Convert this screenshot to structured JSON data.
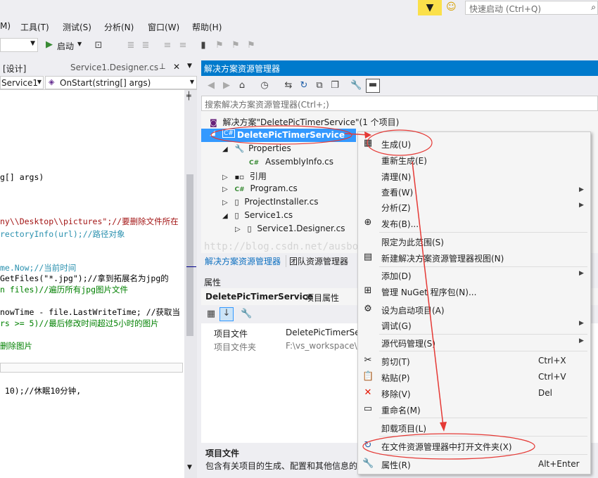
{
  "top": {
    "quick_launch_placeholder": "快速启动 (Ctrl+Q)",
    "notification_icon": "filter-icon",
    "smiley_icon": "smiley-icon"
  },
  "menubar": {
    "items": [
      "M)",
      "工具(T)",
      "测试(S)",
      "分析(N)",
      "窗口(W)",
      "帮助(H)"
    ]
  },
  "toolbar": {
    "start_label": "启动"
  },
  "editor": {
    "tab_design": "[设计]",
    "tab_file": "Service1.Designer.cs",
    "combo_class": "Service1",
    "combo_method": "OnStart(string[] args)",
    "lines": [
      "g[] args)",
      "ny\\\\Desktop\\\\pictures\";//要删除文件所在",
      "rectoryInfo(url);//路径对象",
      "me.Now;//当前时间",
      "GetFiles(\"*.jpg\");//拿到拓展名为jpg的",
      "n files)//遍历所有jpg图片文件",
      "nowTime - file.LastWriteTime; //获取当",
      "rs >= 5)//最后修改时间超过5小时的图片",
      "删除图片",
      " 10);//休眠10分钟,"
    ]
  },
  "solution_explorer": {
    "title": "解决方案资源管理器",
    "search_placeholder": "搜索解决方案资源管理器(Ctrl+;)",
    "tree": {
      "solution": "解决方案\"DeletePicTimerService\"(1 个项目)",
      "project": "DeletePicTimerService",
      "properties": "Properties",
      "assemblyinfo": "AssemblyInfo.cs",
      "references": "引用",
      "program": "Program.cs",
      "projectinstaller": "ProjectInstaller.cs",
      "service1": "Service1.cs",
      "service1_designer": "Service1.Designer.cs"
    },
    "tab_se": "解决方案资源管理器",
    "tab_team": "团队资源管理器",
    "watermark": "http://blog.csdn.net/ausboyue"
  },
  "properties": {
    "title": "属性",
    "object_name": "DeletePicTimerService",
    "object_type": "项目属性",
    "rows": [
      {
        "name": "项目文件",
        "value": "DeletePicTimerSe"
      },
      {
        "name": "项目文件夹",
        "value": "F:\\vs_workspace\\"
      }
    ],
    "desc_title": "项目文件",
    "desc_text": "包含有关项目的生成、配置和其他信息的"
  },
  "context_menu": {
    "items": [
      {
        "label": "生成(U)",
        "shortcut": "",
        "icon": "build-icon",
        "submenu": false
      },
      {
        "label": "重新生成(E)",
        "shortcut": "",
        "icon": "",
        "submenu": false
      },
      {
        "label": "清理(N)",
        "shortcut": "",
        "icon": "",
        "submenu": false
      },
      {
        "label": "查看(W)",
        "shortcut": "",
        "icon": "",
        "submenu": true
      },
      {
        "label": "分析(Z)",
        "shortcut": "",
        "icon": "",
        "submenu": true
      },
      {
        "label": "发布(B)...",
        "shortcut": "",
        "icon": "globe-icon",
        "submenu": false
      },
      {
        "label": "限定为此范围(S)",
        "shortcut": "",
        "icon": "",
        "submenu": false
      },
      {
        "label": "新建解决方案资源管理器视图(N)",
        "shortcut": "",
        "icon": "new-view-icon",
        "submenu": false
      },
      {
        "label": "添加(D)",
        "shortcut": "",
        "icon": "",
        "submenu": true
      },
      {
        "label": "管理 NuGet 程序包(N)...",
        "shortcut": "",
        "icon": "nuget-icon",
        "submenu": false
      },
      {
        "label": "设为启动项目(A)",
        "shortcut": "",
        "icon": "gear-icon",
        "submenu": false
      },
      {
        "label": "调试(G)",
        "shortcut": "",
        "icon": "",
        "submenu": true
      },
      {
        "label": "源代码管理(S)",
        "shortcut": "",
        "icon": "",
        "submenu": true
      },
      {
        "label": "剪切(T)",
        "shortcut": "Ctrl+X",
        "icon": "scissors-icon",
        "submenu": false
      },
      {
        "label": "粘贴(P)",
        "shortcut": "Ctrl+V",
        "icon": "paste-icon",
        "submenu": false
      },
      {
        "label": "移除(V)",
        "shortcut": "Del",
        "icon": "remove-icon",
        "submenu": false
      },
      {
        "label": "重命名(M)",
        "shortcut": "",
        "icon": "rename-icon",
        "submenu": false
      },
      {
        "label": "卸载项目(L)",
        "shortcut": "",
        "icon": "",
        "submenu": false
      },
      {
        "label": "在文件资源管理器中打开文件夹(X)",
        "shortcut": "",
        "icon": "refresh-folder-icon",
        "submenu": false
      },
      {
        "label": "属性(R)",
        "shortcut": "Alt+Enter",
        "icon": "wrench-icon",
        "submenu": false
      }
    ]
  },
  "colors": {
    "accent": "#007acc",
    "annotation_red": "#e53935"
  }
}
